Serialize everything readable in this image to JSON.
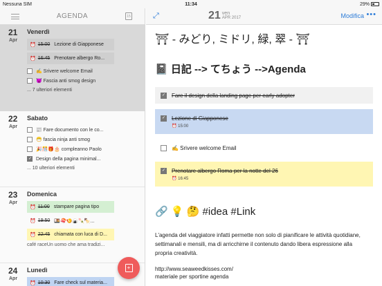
{
  "status": {
    "carrier": "Nessuna SIM",
    "time": "11:34",
    "battery": "29%"
  },
  "sidebar": {
    "title": "AGENDA",
    "calendar_icon_label": "15",
    "days": [
      {
        "num": "21",
        "mon": "Apr",
        "name": "Venerdì",
        "events": [
          {
            "time": "15:00",
            "title": "Lezione di Giapponese",
            "color": "grey"
          },
          {
            "time": "16:45",
            "title": "Prenotare albergo Ro...",
            "color": "grey"
          }
        ],
        "tasks": [
          {
            "checked": false,
            "text": "✍️ Srivere welcome Email"
          },
          {
            "checked": false,
            "text": "😈 Fascia anti smog design"
          }
        ],
        "more": "... 7 ulteriori elementi"
      },
      {
        "num": "22",
        "mon": "Apr",
        "name": "Sabato",
        "events": [],
        "tasks": [
          {
            "checked": false,
            "text": "📰 Fare documento con le co..."
          },
          {
            "checked": false,
            "text": "😷 fascia ninja anti smog"
          },
          {
            "checked": false,
            "text": "🎉🎊🎁🎂 compleanno Paolo"
          },
          {
            "checked": true,
            "text": "Design della pagina minimal..."
          }
        ],
        "more": "... 10 ulteriori elementi"
      },
      {
        "num": "23",
        "mon": "Apr",
        "name": "Domenica",
        "events": [
          {
            "time": "11:00",
            "title": "stampare pagina tipo",
            "color": "green"
          },
          {
            "time": "19:50",
            "title": "🍱🍣🍤🍙🍡🍢...",
            "color": "white"
          },
          {
            "time": "22:45",
            "title": "chiamata con luca di D...",
            "color": "yellow"
          }
        ],
        "tasks": [],
        "cafe": "café raceUn uomo che ama tradizi...",
        "more": ""
      },
      {
        "num": "24",
        "mon": "Apr",
        "name": "Lunedì",
        "events": [
          {
            "time": "10:30",
            "title": "Fare check sul materia...",
            "color": "blue"
          }
        ],
        "tasks": [],
        "more": ""
      }
    ]
  },
  "main": {
    "day_num": "21",
    "weekday": "ven",
    "month_year": "APR 2017",
    "edit_label": "Modifica",
    "more_label": "•••",
    "heading1": "⛩ - みどり, ミドリ, 緑, 翠 - ⛩",
    "heading2": "📓 日記 --> てちょう -->Agenda",
    "tasks": [
      {
        "style": "grey",
        "checked": true,
        "text": "Fare il design della landing page per early adopter",
        "strike": true,
        "time": ""
      },
      {
        "style": "blue",
        "checked": true,
        "text": "Lezione di Giapponese",
        "strike": true,
        "time": "15:00"
      },
      {
        "style": "white",
        "checked": false,
        "text": "✍️ Srivere welcome Email",
        "strike": false,
        "time": ""
      },
      {
        "style": "yellow",
        "checked": true,
        "text": "Prenotare albergo Roma per la notte del 26",
        "strike": true,
        "time": "16:45"
      }
    ],
    "heading3": "🔗 💡 🤔 #idea #Link",
    "paragraph": "L'agenda del viaggiatore infatti permette non solo di pianificare le attività quotidiane, settimanali e mensili, ma di arricchirne il contenuto dando libera espressione alla propria creatività.",
    "link": "http://www.seaweedkisses.com/",
    "link2": "materiale per sportine agenda"
  },
  "colors": {
    "accent": "#2d7cd8",
    "fab": "#ef5b5b"
  }
}
